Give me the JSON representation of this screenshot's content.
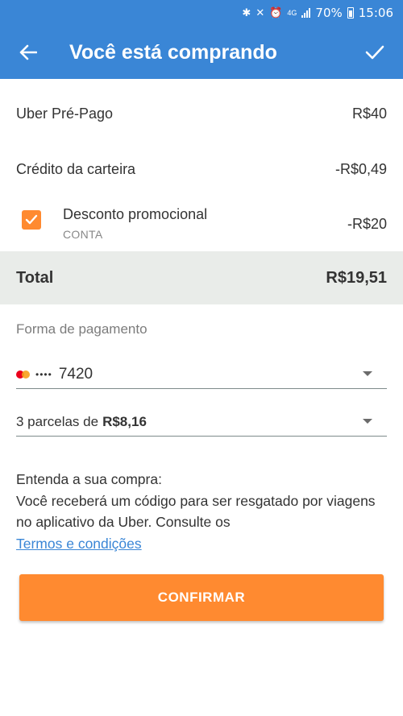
{
  "status_bar": {
    "battery": "70%",
    "time": "15:06",
    "network": "4G"
  },
  "app_bar": {
    "title": "Você está comprando",
    "back_icon": "arrow-left-icon",
    "confirm_icon": "check-icon"
  },
  "summary": {
    "product": {
      "label": "Uber Pré-Pago",
      "value": "R$40"
    },
    "wallet_credit": {
      "label": "Crédito da carteira",
      "value": "-R$0,49"
    },
    "promo": {
      "label": "Desconto promocional",
      "sub": "CONTA",
      "value": "-R$20",
      "checked": true
    },
    "total": {
      "label": "Total",
      "value": "R$19,51"
    }
  },
  "payment": {
    "title": "Forma de pagamento",
    "card": {
      "brand": "mastercard-icon",
      "masked": "••••",
      "last4": "7420"
    },
    "installments": {
      "prefix": "3 parcelas de",
      "amount": "R$8,16"
    }
  },
  "info": {
    "line1": "Entenda a sua compra:",
    "line2": "Você receberá um código para ser resgatado por viagens no aplicativo da Uber. Consulte os",
    "link": "Termos e condições"
  },
  "confirm_button": {
    "label": "CONFIRMAR"
  },
  "colors": {
    "primary": "#3a86d6",
    "accent": "#ff8a30",
    "total_bg": "#e9ece9"
  }
}
